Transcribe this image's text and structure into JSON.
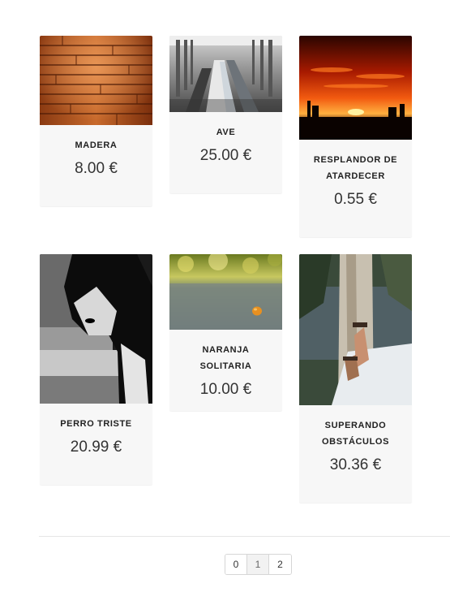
{
  "products": [
    {
      "title": "MADERA",
      "price": "8.00 €"
    },
    {
      "title": "AVE",
      "price": "25.00 €"
    },
    {
      "title": "RESPLANDOR DE ATARDECER",
      "price": "0.55 €"
    },
    {
      "title": "PERRO TRISTE",
      "price": "20.99 €"
    },
    {
      "title": "NARANJA SOLITARIA",
      "price": "10.00 €"
    },
    {
      "title": "SUPERANDO OBSTÁCULOS",
      "price": "30.36 €"
    }
  ],
  "pagination": {
    "pages": [
      "0",
      "1",
      "2"
    ],
    "current": "1"
  }
}
